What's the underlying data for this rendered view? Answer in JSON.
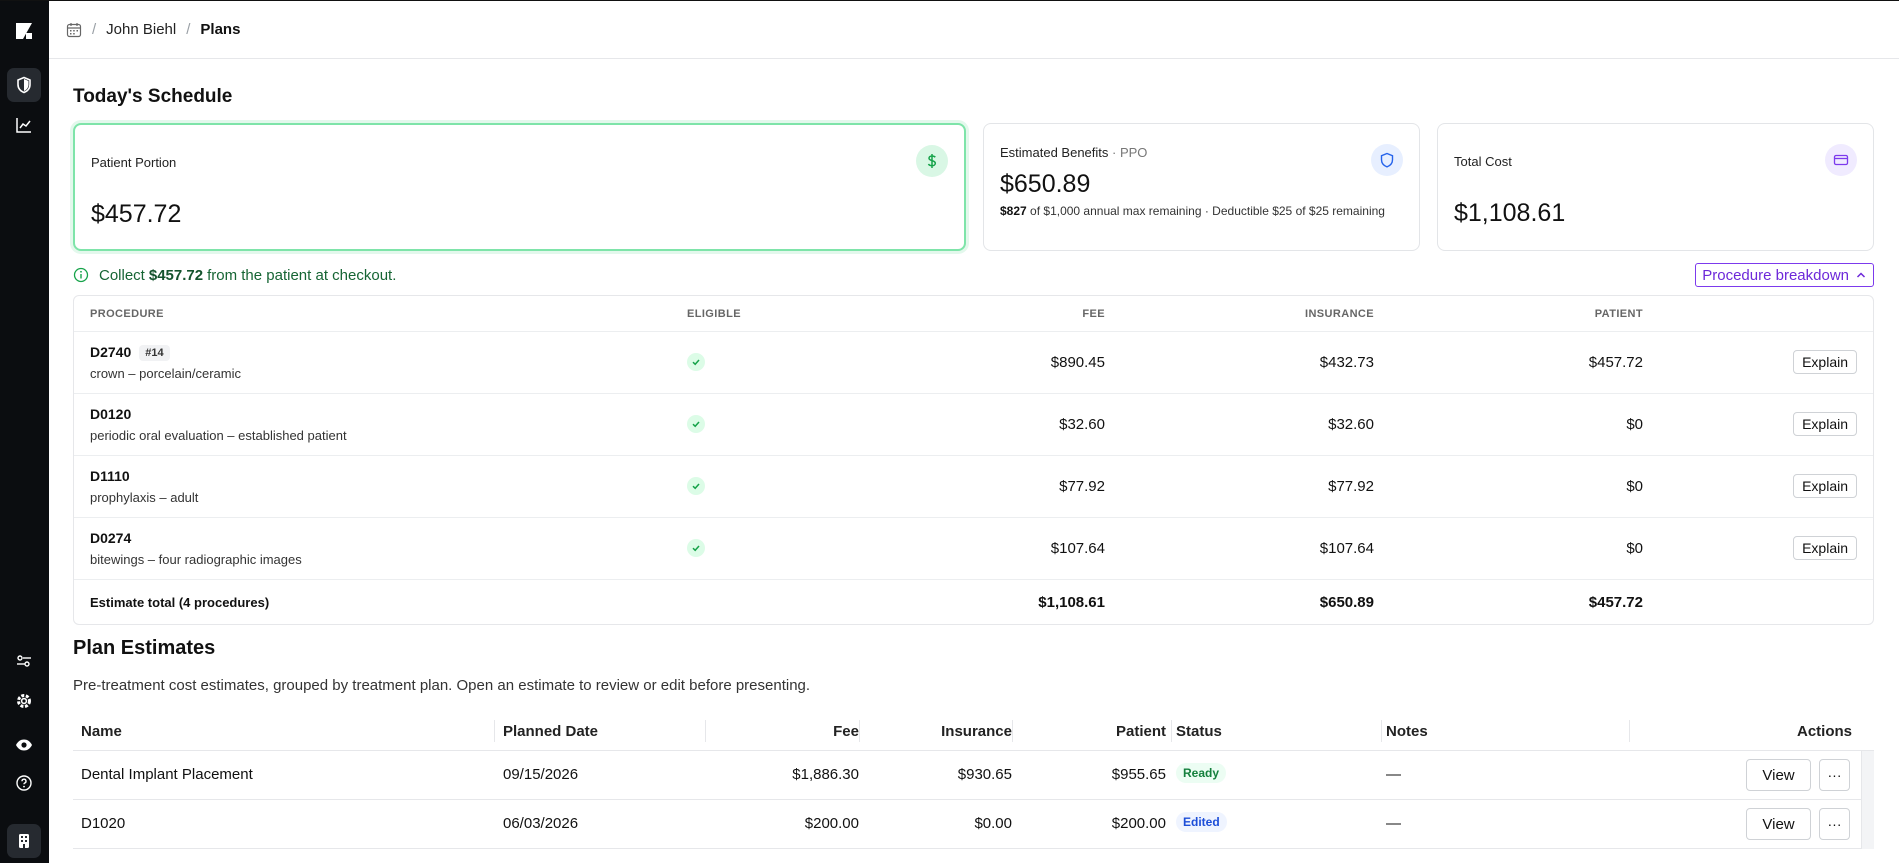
{
  "breadcrumb": {
    "patient": "John Biehl",
    "page": "Plans"
  },
  "schedule": {
    "title": "Today's Schedule",
    "patient_portion": {
      "label": "Patient Portion",
      "amount": "$457.72"
    },
    "benefits": {
      "label": "Estimated Benefits",
      "plan_type": "· PPO",
      "amount": "$650.89",
      "max_remaining": "$827",
      "max_text": "of $1,000 annual max remaining",
      "deductible_text": "· Deductible $25 of $25 remaining"
    },
    "total_cost": {
      "label": "Total Cost",
      "amount": "$1,108.61"
    },
    "collect": {
      "pre": "Collect",
      "amount": "$457.72",
      "post": "from the patient at checkout."
    },
    "breakdown_button": "Procedure breakdown"
  },
  "procedures": {
    "headers": {
      "procedure": "PROCEDURE",
      "eligible": "ELIGIBLE",
      "fee": "FEE",
      "insurance": "INSURANCE",
      "patient": "PATIENT"
    },
    "rows": [
      {
        "code": "D2740",
        "tag": "#14",
        "desc": "crown – porcelain/ceramic",
        "fee": "$890.45",
        "insurance": "$432.73",
        "patient": "$457.72",
        "action": "Explain"
      },
      {
        "code": "D0120",
        "tag": "",
        "desc": "periodic oral evaluation – established patient",
        "fee": "$32.60",
        "insurance": "$32.60",
        "patient": "$0",
        "action": "Explain"
      },
      {
        "code": "D1110",
        "tag": "",
        "desc": "prophylaxis – adult",
        "fee": "$77.92",
        "insurance": "$77.92",
        "patient": "$0",
        "action": "Explain"
      },
      {
        "code": "D0274",
        "tag": "",
        "desc": "bitewings – four radiographic images",
        "fee": "$107.64",
        "insurance": "$107.64",
        "patient": "$0",
        "action": "Explain"
      }
    ],
    "total": {
      "label": "Estimate total (4 procedures)",
      "fee": "$1,108.61",
      "insurance": "$650.89",
      "patient": "$457.72"
    }
  },
  "plan_estimates": {
    "title": "Plan Estimates",
    "description": "Pre-treatment cost estimates, grouped by treatment plan. Open an estimate to review or edit before presenting.",
    "headers": {
      "name": "Name",
      "planned_date": "Planned Date",
      "fee": "Fee",
      "insurance": "Insurance",
      "patient": "Patient",
      "status": "Status",
      "notes": "Notes",
      "actions": "Actions"
    },
    "rows": [
      {
        "name": "Dental Implant Placement",
        "planned_date": "09/15/2026",
        "fee": "$1,886.30",
        "insurance": "$930.65",
        "patient": "$955.65",
        "status": "Ready",
        "notes": "—",
        "view": "View",
        "more": "···"
      },
      {
        "name": "D1020",
        "planned_date": "06/03/2026",
        "fee": "$200.00",
        "insurance": "$0.00",
        "patient": "$200.00",
        "status": "Edited",
        "notes": "—",
        "view": "View",
        "more": "···"
      }
    ]
  },
  "colors": {
    "accent_green": "#16a34a",
    "accent_purple": "#6d28d9",
    "rail": "#0b0d10"
  }
}
